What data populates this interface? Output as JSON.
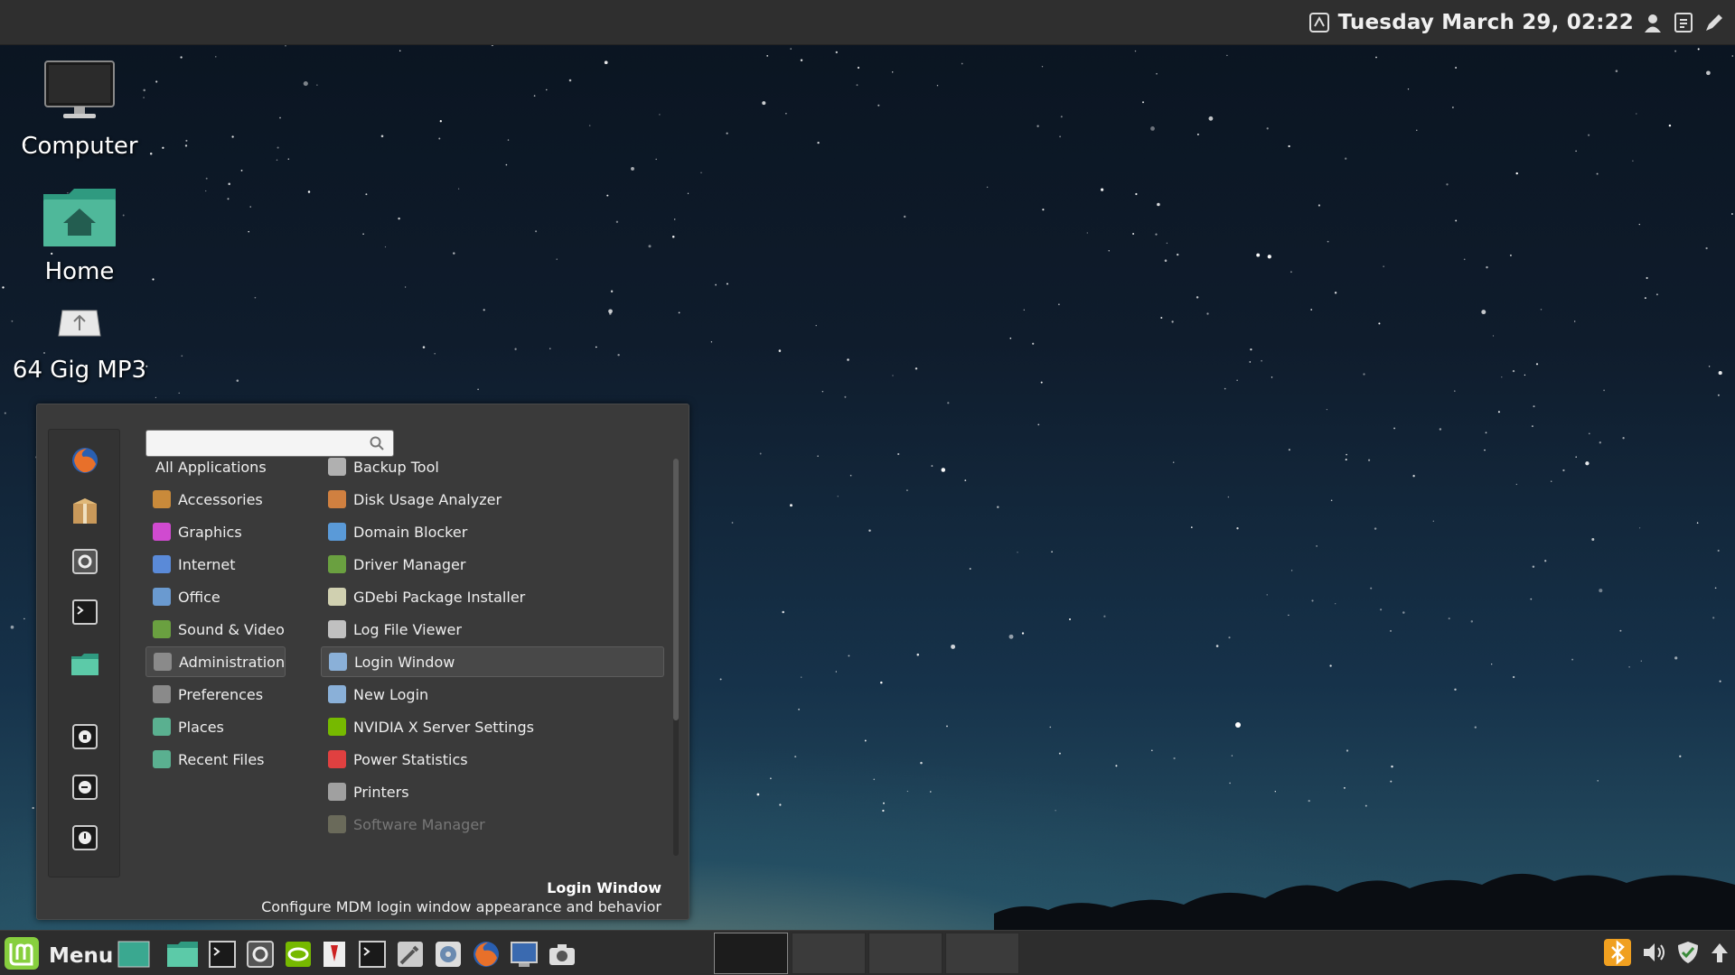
{
  "panel_top": {
    "clock": "Tuesday March 29, 02:22",
    "tray_icons": [
      "network-icon",
      "user-icon",
      "clipboard-icon",
      "pen-icon"
    ]
  },
  "desktop_icons": [
    {
      "label": "Computer",
      "icon": "computer-icon"
    },
    {
      "label": "Home",
      "icon": "home-folder-icon"
    },
    {
      "label": "64 Gig MP3",
      "icon": "usb-drive-icon"
    }
  ],
  "menu": {
    "search": {
      "value": "",
      "placeholder": ""
    },
    "favorites": [
      "firefox-icon",
      "package-icon",
      "settings-icon",
      "terminal-icon",
      "folder-icon",
      "lock-icon",
      "logout-icon",
      "power-icon"
    ],
    "categories": [
      {
        "label": "All Applications",
        "icon": "",
        "color": ""
      },
      {
        "label": "Accessories",
        "icon": "accessories-icon",
        "color": "#c98a3a"
      },
      {
        "label": "Graphics",
        "icon": "graphics-icon",
        "color": "#d04ad0"
      },
      {
        "label": "Internet",
        "icon": "internet-icon",
        "color": "#5a8ad8"
      },
      {
        "label": "Office",
        "icon": "office-icon",
        "color": "#6a9ad0"
      },
      {
        "label": "Sound & Video",
        "icon": "multimedia-icon",
        "color": "#6aa040"
      },
      {
        "label": "Administration",
        "icon": "administration-icon",
        "color": "#8a8a8a"
      },
      {
        "label": "Preferences",
        "icon": "preferences-icon",
        "color": "#8a8a8a"
      },
      {
        "label": "Places",
        "icon": "folder-icon",
        "color": "#5ab090"
      },
      {
        "label": "Recent Files",
        "icon": "recent-folder-icon",
        "color": "#5ab090"
      }
    ],
    "selected_category": "Administration",
    "apps": [
      {
        "label": "Backup Tool",
        "icon": "backup-icon",
        "color": "#b0b0b0"
      },
      {
        "label": "Disk Usage Analyzer",
        "icon": "disk-usage-icon",
        "color": "#d08040"
      },
      {
        "label": "Domain Blocker",
        "icon": "domain-blocker-icon",
        "color": "#5a9ad8"
      },
      {
        "label": "Driver Manager",
        "icon": "driver-manager-icon",
        "color": "#6aa040"
      },
      {
        "label": "GDebi Package Installer",
        "icon": "package-installer-icon",
        "color": "#d0d0b0"
      },
      {
        "label": "Log File Viewer",
        "icon": "log-viewer-icon",
        "color": "#c0c0c0"
      },
      {
        "label": "Login Window",
        "icon": "login-window-icon",
        "color": "#8ab0d8"
      },
      {
        "label": "New Login",
        "icon": "new-login-icon",
        "color": "#8ab0d8"
      },
      {
        "label": "NVIDIA X Server Settings",
        "icon": "nvidia-icon",
        "color": "#76b900"
      },
      {
        "label": "Power Statistics",
        "icon": "power-statistics-icon",
        "color": "#e04040"
      },
      {
        "label": "Printers",
        "icon": "printer-icon",
        "color": "#a0a0a0"
      },
      {
        "label": "Software Manager",
        "icon": "software-manager-icon",
        "color": "#6a6a5a"
      }
    ],
    "selected_app": "Login Window",
    "description": {
      "title": "Login Window",
      "text": "Configure MDM login window appearance and behavior"
    }
  },
  "taskbar": {
    "menu_label": "Menu",
    "launchers": [
      "show-desktop-icon",
      "files-icon",
      "terminal-icon",
      "settings-icon",
      "nvidia-icon",
      "text-editor-icon",
      "terminal-icon",
      "tools-icon",
      "disk-icon",
      "firefox-icon",
      "monitor-icon",
      "camera-icon"
    ],
    "workspaces": 4,
    "active_workspace": 1,
    "tray_icons": [
      "bluetooth-icon",
      "volume-icon",
      "shield-icon",
      "update-arrow-icon"
    ]
  },
  "colors": {
    "panel": "#2f2f2f",
    "menu_bg": "#3a3a3a",
    "mint_green": "#87cf3e",
    "folder_teal": "#4fb89a"
  }
}
